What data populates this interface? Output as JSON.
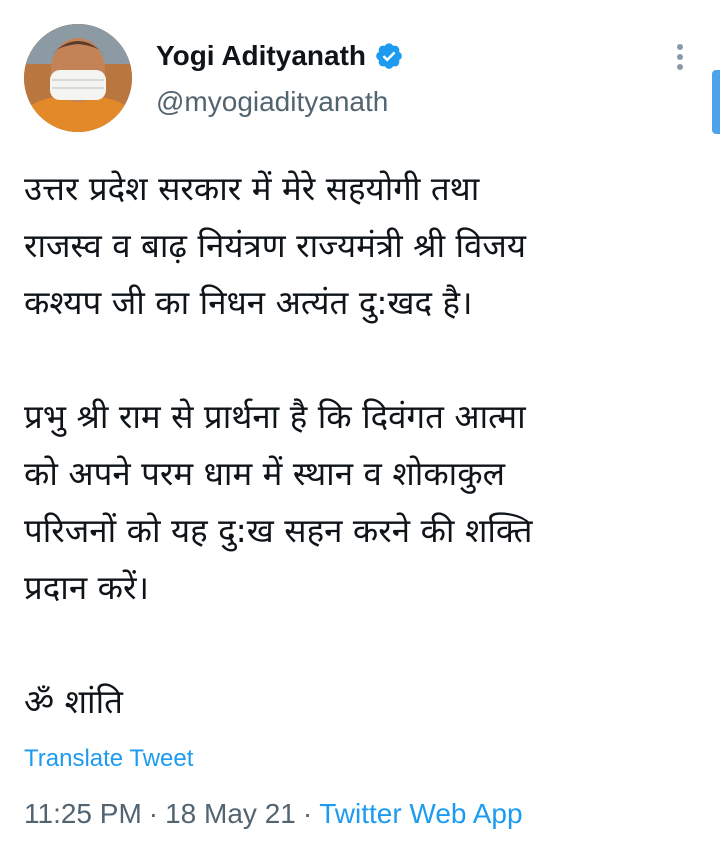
{
  "author": {
    "name": "Yogi Adityanath",
    "handle": "@myogiadityanath",
    "verified": true,
    "avatar_icon": "profile-photo-icon"
  },
  "tweet": {
    "lines": [
      "उत्तर प्रदेश सरकार में मेरे सहयोगी तथा",
      "राजस्व व बाढ़ नियंत्रण राज्यमंत्री श्री विजय",
      "कश्यप जी का निधन अत्यंत दु:खद है।",
      "प्रभु श्री राम से प्रार्थना है कि दिवंगत आत्मा",
      "को अपने परम धाम में स्थान व शोकाकुल",
      "परिजनों को यह दु:ख सहन करने की शक्ति",
      "प्रदान करें।",
      "ॐ शांति"
    ],
    "translate_label": "Translate Tweet",
    "time": "11:25 PM",
    "date": "18 May 21",
    "source": "Twitter Web App",
    "separator": "·"
  },
  "icons": {
    "more": "more-vertical-icon",
    "verified": "verified-badge-icon"
  },
  "colors": {
    "link": "#1d9bf0",
    "secondary_text": "#536471",
    "primary_text": "#0f1419"
  }
}
